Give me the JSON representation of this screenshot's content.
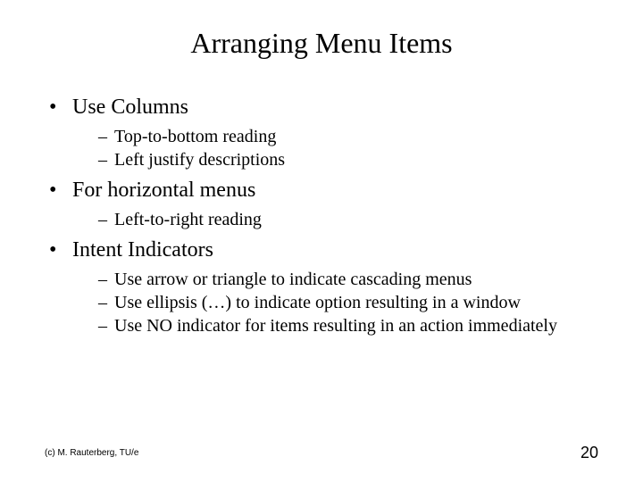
{
  "title": "Arranging Menu Items",
  "bullets": [
    {
      "text": "Use Columns",
      "sub": [
        "Top-to-bottom reading",
        "Left justify descriptions"
      ]
    },
    {
      "text": "For horizontal menus",
      "sub": [
        "Left-to-right reading"
      ]
    },
    {
      "text": "Intent Indicators",
      "sub": [
        "Use arrow or triangle to indicate cascading menus",
        "Use ellipsis (…) to indicate option resulting in a window",
        "Use NO indicator for items resulting in an action immediately"
      ]
    }
  ],
  "footer": {
    "copyright": "(c) M. Rauterberg, TU/e",
    "page_number": "20"
  }
}
